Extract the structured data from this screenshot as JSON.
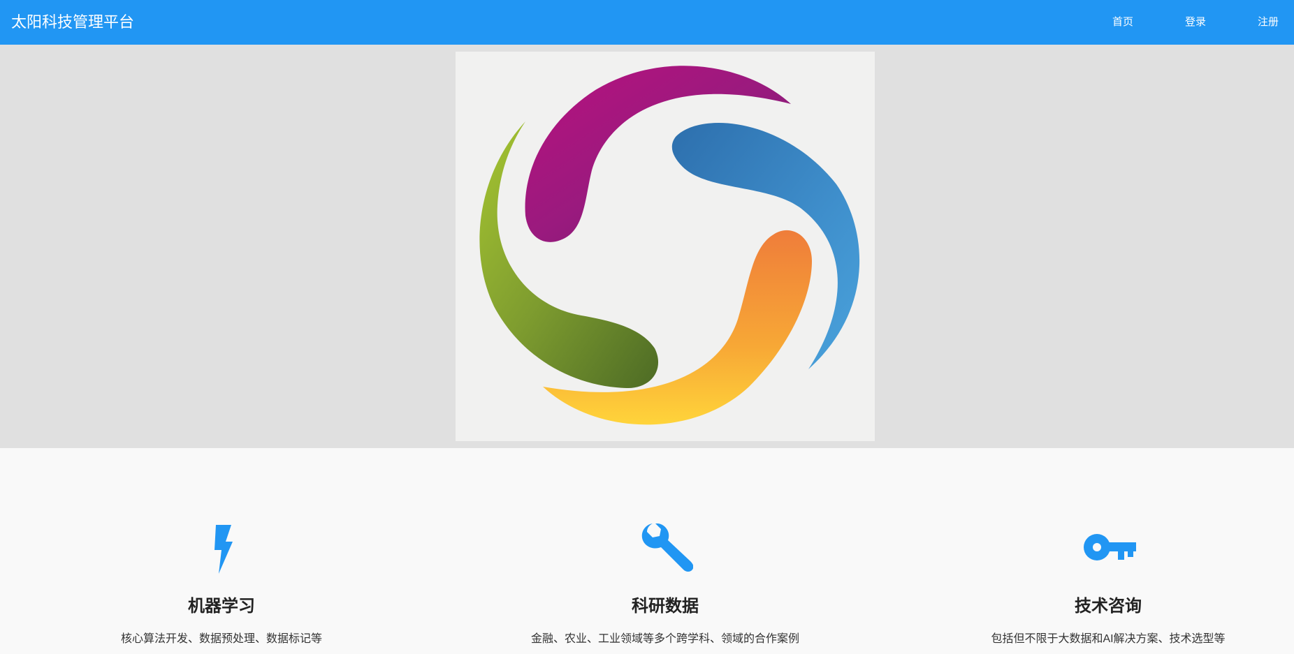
{
  "navbar": {
    "brand": "太阳科技管理平台",
    "links": [
      {
        "label": "首页"
      },
      {
        "label": "登录"
      },
      {
        "label": "注册"
      }
    ],
    "color": "#2196f3"
  },
  "hero": {
    "image": "colorful-swirl-logo",
    "background": "#e0e0e0"
  },
  "features": [
    {
      "icon": "lightning-bolt-icon",
      "title": "机器学习",
      "description": "核心算法开发、数据预处理、数据标记等"
    },
    {
      "icon": "wrench-icon",
      "title": "科研数据",
      "description": "金融、农业、工业领域等多个跨学科、领域的合作案例"
    },
    {
      "icon": "key-icon",
      "title": "技术咨询",
      "description": "包括但不限于大数据和AI解决方案、技术选型等"
    }
  ],
  "accent_color": "#2196f3"
}
